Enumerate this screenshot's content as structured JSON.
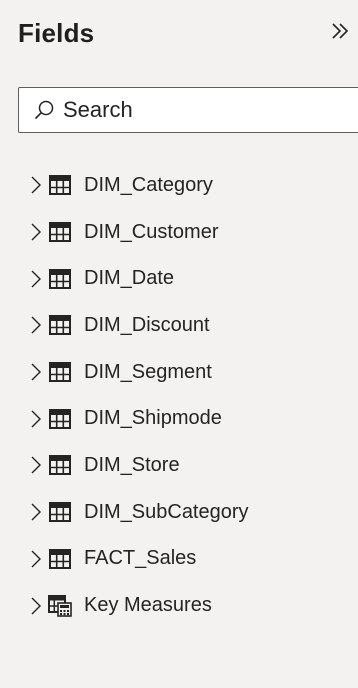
{
  "header": {
    "title": "Fields",
    "collapse_icon": "double-chevron-right-icon"
  },
  "search": {
    "placeholder": "Search",
    "value": "",
    "icon": "search-icon"
  },
  "fields": [
    {
      "label": "DIM_Category",
      "icon": "table-icon"
    },
    {
      "label": "DIM_Customer",
      "icon": "table-icon"
    },
    {
      "label": "DIM_Date",
      "icon": "table-icon"
    },
    {
      "label": "DIM_Discount",
      "icon": "table-icon"
    },
    {
      "label": "DIM_Segment",
      "icon": "table-icon"
    },
    {
      "label": "DIM_Shipmode",
      "icon": "table-icon"
    },
    {
      "label": "DIM_Store",
      "icon": "table-icon"
    },
    {
      "label": "DIM_SubCategory",
      "icon": "table-icon"
    },
    {
      "label": "FACT_Sales",
      "icon": "table-icon"
    },
    {
      "label": "Key Measures",
      "icon": "measure-table-icon"
    }
  ],
  "colors": {
    "panel_background": "#f3f2f1",
    "search_background": "#ffffff",
    "border": "#605e5c",
    "text": "#252423"
  }
}
